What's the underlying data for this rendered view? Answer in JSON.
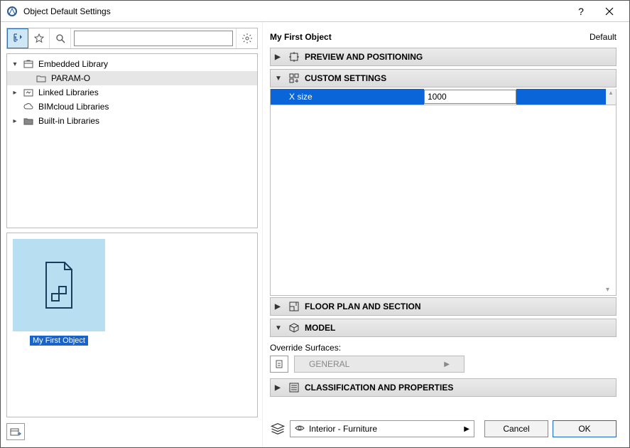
{
  "window": {
    "title": "Object Default Settings"
  },
  "toolbar": {
    "search_placeholder": ""
  },
  "tree": {
    "items": [
      {
        "label": "Embedded Library"
      },
      {
        "label": "PARAM-O"
      },
      {
        "label": "Linked Libraries"
      },
      {
        "label": "BIMcloud Libraries"
      },
      {
        "label": "Built-in Libraries"
      }
    ]
  },
  "preview": {
    "selected_label": "My First Object"
  },
  "right": {
    "title": "My First Object",
    "default_label": "Default",
    "sections": {
      "preview": "PREVIEW AND POSITIONING",
      "custom": "CUSTOM SETTINGS",
      "floorplan": "FLOOR PLAN AND SECTION",
      "model": "MODEL",
      "class": "CLASSIFICATION AND PROPERTIES"
    },
    "param": {
      "name": "X size",
      "value": "1000"
    },
    "override_label": "Override Surfaces:",
    "general_label": "GENERAL",
    "layer": "Interior - Furniture"
  },
  "buttons": {
    "cancel": "Cancel",
    "ok": "OK"
  }
}
